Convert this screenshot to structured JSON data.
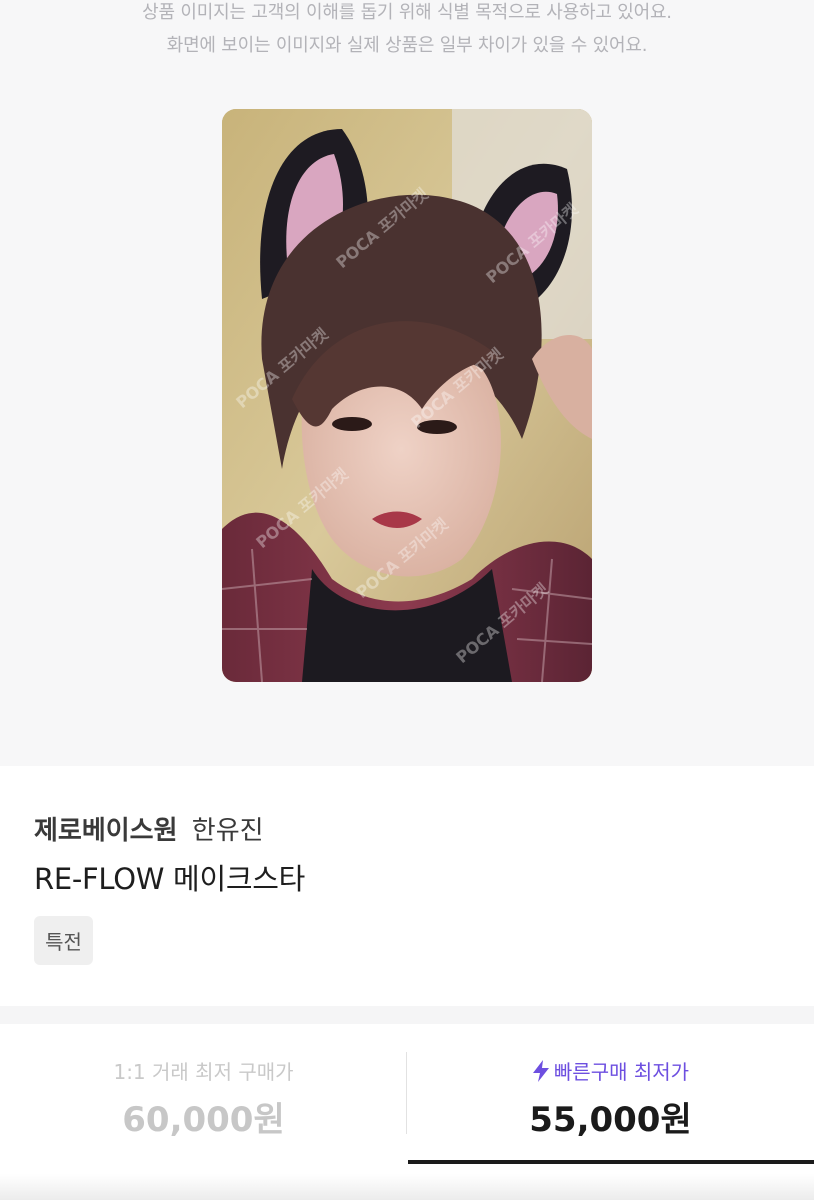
{
  "notice": {
    "line1": "상품 이미지는 고객의 이해를 돕기 위해 식별 목적으로 사용하고 있어요.",
    "line2": "화면에 보이는 이미지와 실제 상품은 일부 차이가 있을 수 있어요."
  },
  "product": {
    "group": "제로베이스원",
    "member": "한유진",
    "name": "RE-FLOW 메이크스타",
    "tag": "특전",
    "watermark": "POCA 포카마켓"
  },
  "prices": {
    "left_label": "1:1 거래 최저 구매가",
    "left_value": "60,000원",
    "right_label": "빠른구매 최저가",
    "right_value": "55,000원",
    "accent_color": "#6d4fe0",
    "right_icon": "lightning-bolt-icon"
  }
}
